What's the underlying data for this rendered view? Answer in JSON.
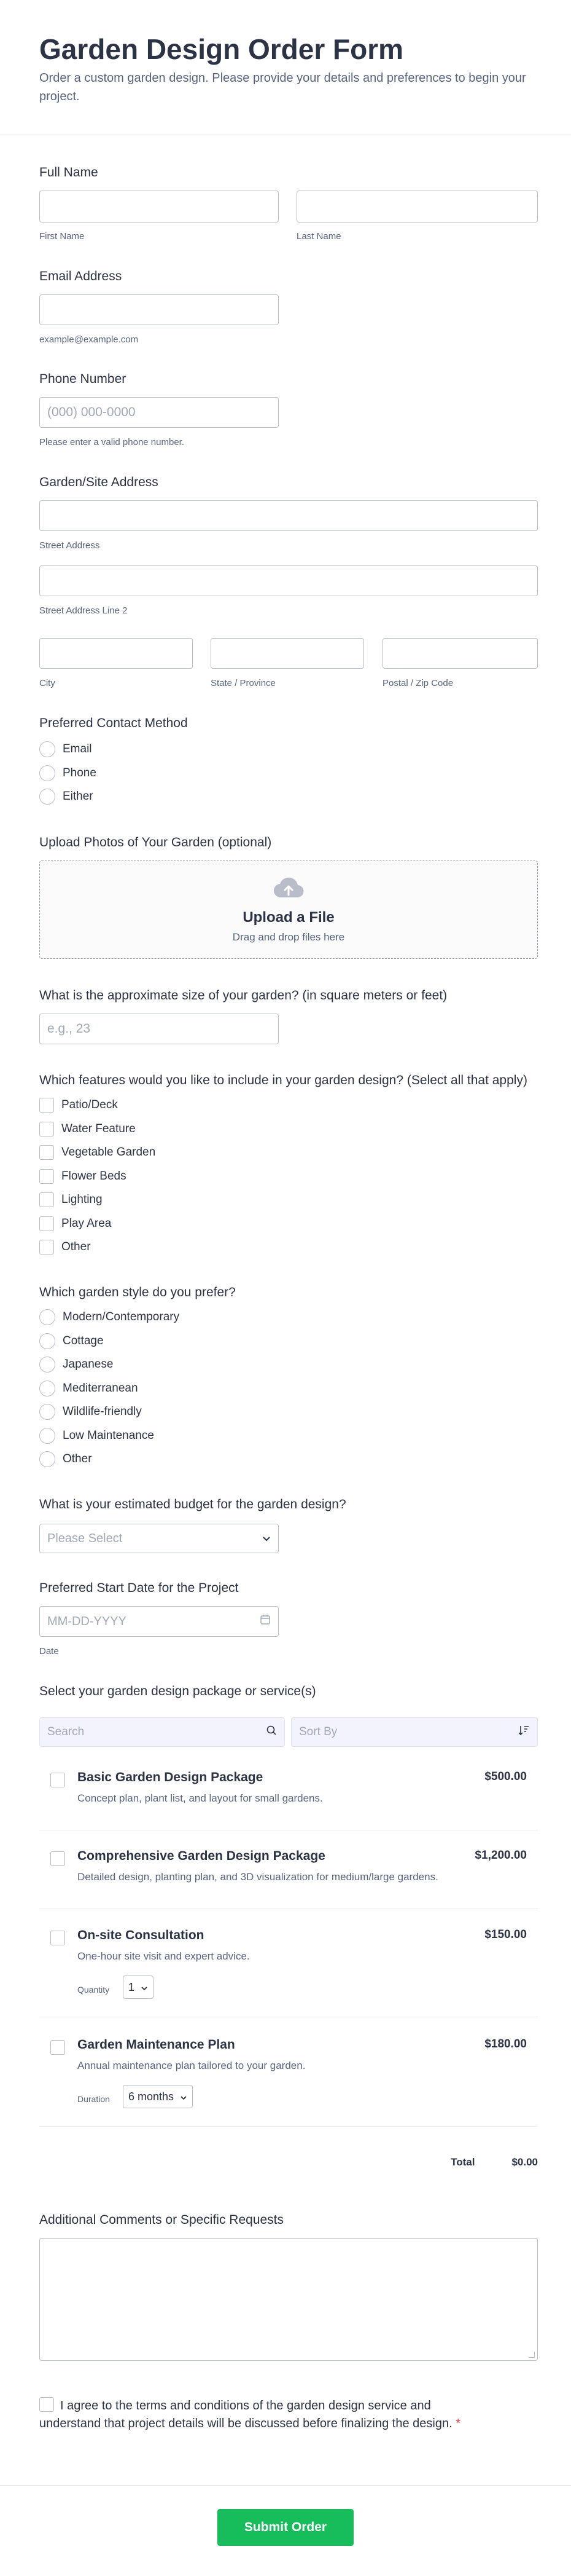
{
  "header": {
    "title": "Garden Design Order Form",
    "subtitle": "Order a custom garden design. Please provide your details and preferences to begin your project."
  },
  "full_name": {
    "label": "Full Name",
    "first_sub": "First Name",
    "last_sub": "Last Name"
  },
  "email": {
    "label": "Email Address",
    "sub": "example@example.com"
  },
  "phone": {
    "label": "Phone Number",
    "placeholder": "(000) 000-0000",
    "sub": "Please enter a valid phone number."
  },
  "address": {
    "label": "Garden/Site Address",
    "street_sub": "Street Address",
    "street2_sub": "Street Address Line 2",
    "city_sub": "City",
    "state_sub": "State / Province",
    "zip_sub": "Postal / Zip Code"
  },
  "contact": {
    "label": "Preferred Contact Method",
    "options": [
      "Email",
      "Phone",
      "Either"
    ]
  },
  "upload": {
    "label": "Upload Photos of Your Garden (optional)",
    "title": "Upload a File",
    "hint": "Drag and drop files here"
  },
  "size": {
    "label": "What is the approximate size of your garden? (in square meters or feet)",
    "placeholder": "e.g., 23"
  },
  "features": {
    "label": "Which features would you like to include in your garden design? (Select all that apply)",
    "options": [
      "Patio/Deck",
      "Water Feature",
      "Vegetable Garden",
      "Flower Beds",
      "Lighting",
      "Play Area",
      "Other"
    ]
  },
  "style": {
    "label": "Which garden style do you prefer?",
    "options": [
      "Modern/Contemporary",
      "Cottage",
      "Japanese",
      "Mediterranean",
      "Wildlife-friendly",
      "Low Maintenance",
      "Other"
    ]
  },
  "budget": {
    "label": "What is your estimated budget for the garden design?",
    "placeholder": "Please Select"
  },
  "start_date": {
    "label": "Preferred Start Date for the Project",
    "placeholder": "MM-DD-YYYY",
    "sub": "Date"
  },
  "packages": {
    "label": "Select your garden design package or service(s)",
    "search_placeholder": "Search",
    "sort_placeholder": "Sort By",
    "items": [
      {
        "name": "Basic Garden Design Package",
        "desc": "Concept plan, plant list, and layout for small gardens.",
        "price": "$500.00"
      },
      {
        "name": "Comprehensive Garden Design Package",
        "desc": "Detailed design, planting plan, and 3D visualization for medium/large gardens.",
        "price": "$1,200.00"
      },
      {
        "name": "On-site Consultation",
        "desc": "One-hour site visit and expert advice.",
        "price": "$150.00",
        "option_label": "Quantity",
        "option_value": "1"
      },
      {
        "name": "Garden Maintenance Plan",
        "desc": "Annual maintenance plan tailored to your garden.",
        "price": "$180.00",
        "option_label": "Duration",
        "option_value": "6 months"
      }
    ],
    "total_label": "Total",
    "total_value": "$0.00"
  },
  "comments": {
    "label": "Additional Comments or Specific Requests"
  },
  "terms": {
    "text": "I agree to the terms and conditions of the garden design service and understand that project details will be discussed before finalizing the design.",
    "required_mark": "*"
  },
  "submit": {
    "label": "Submit Order"
  },
  "colors": {
    "accent": "#18bd5b",
    "border": "#b8bdc9",
    "text": "#2c3345",
    "muted": "#57647e"
  }
}
